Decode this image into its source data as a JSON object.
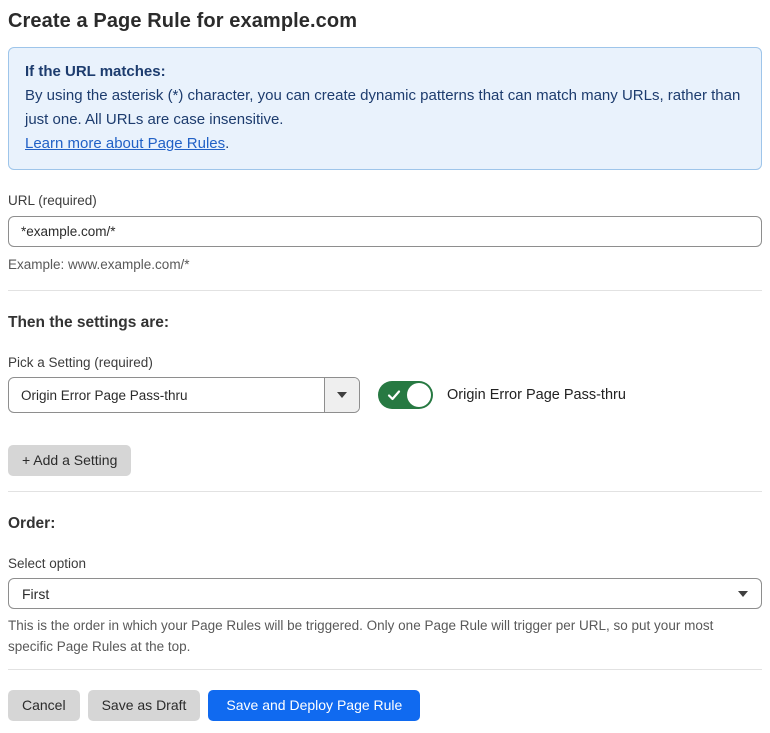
{
  "page": {
    "title": "Create a Page Rule for example.com"
  },
  "info_box": {
    "heading": "If the URL matches:",
    "body": "By using the asterisk (*) character, you can create dynamic patterns that can match many URLs, rather than just one. All URLs are case insensitive.",
    "link_text": "Learn more about Page Rules",
    "link_suffix": "."
  },
  "url_field": {
    "label": "URL (required)",
    "value": "*example.com/*",
    "helper": "Example: www.example.com/*"
  },
  "settings_section": {
    "heading": "Then the settings are:",
    "picker_label": "Pick a Setting (required)",
    "picker_value": "Origin Error Page Pass-thru",
    "toggle_state": "on",
    "toggle_label": "Origin Error Page Pass-thru",
    "add_setting_button": "+ Add a Setting"
  },
  "order_section": {
    "heading": "Order:",
    "select_label": "Select option",
    "select_value": "First",
    "helper": "This is the order in which your Page Rules will be triggered. Only one Page Rule will trigger per URL, so put your most specific Page Rules at the top."
  },
  "footer": {
    "cancel_label": "Cancel",
    "save_draft_label": "Save as Draft",
    "save_deploy_label": "Save and Deploy Page Rule"
  },
  "colors": {
    "info_bg": "#e9f2fc",
    "info_border": "#9ec5ea",
    "info_text": "#1d3c6e",
    "link": "#2161c6",
    "toggle_on": "#277942",
    "primary_button": "#106af0",
    "secondary_button": "#d6d6d6"
  }
}
